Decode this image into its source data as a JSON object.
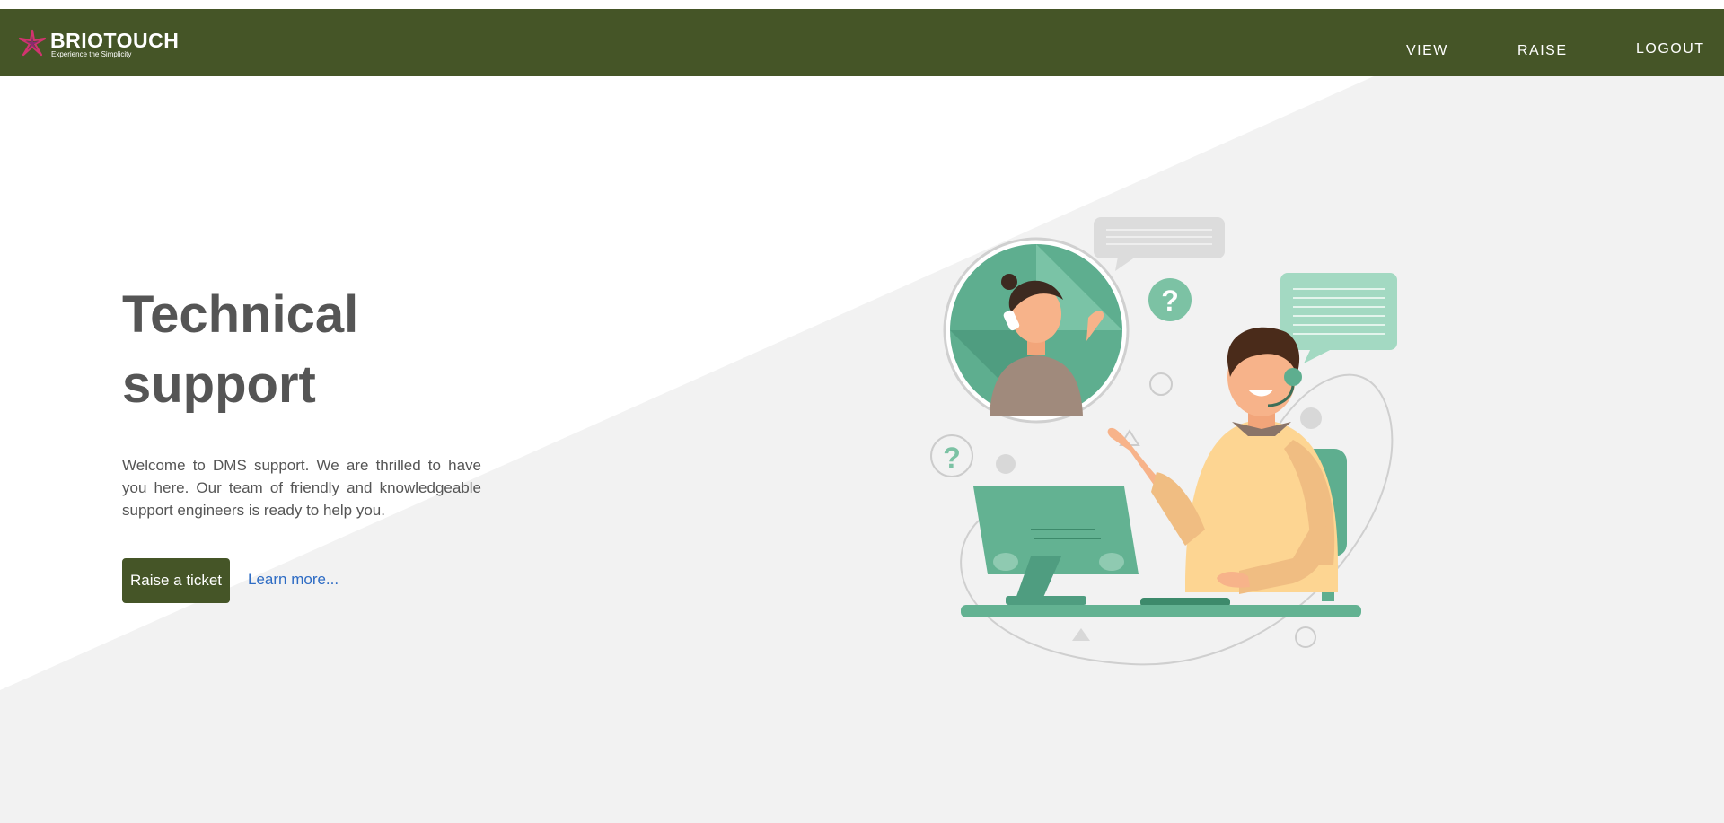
{
  "brand": {
    "name": "BRIOTOUCH",
    "tagline": "Experience the Simplicity"
  },
  "nav": {
    "items": [
      {
        "label": "VIEW"
      },
      {
        "label": "RAISE"
      },
      {
        "label": "LOGOUT"
      }
    ]
  },
  "hero": {
    "title_line1": "Technical",
    "title_line2": "support",
    "description": "Welcome to DMS support. We are thrilled to have you here. Our team of friendly and knowledgeable support engineers is ready to help you.",
    "primary_button": "Raise a ticket",
    "secondary_link": "Learn more..."
  },
  "illustration": {
    "question_mark": "?"
  },
  "colors": {
    "navbar": "#455527",
    "primary_button": "#455527",
    "link": "#2e6cc4",
    "accent_green": "#63b292",
    "background_gray": "#f2f2f2"
  }
}
